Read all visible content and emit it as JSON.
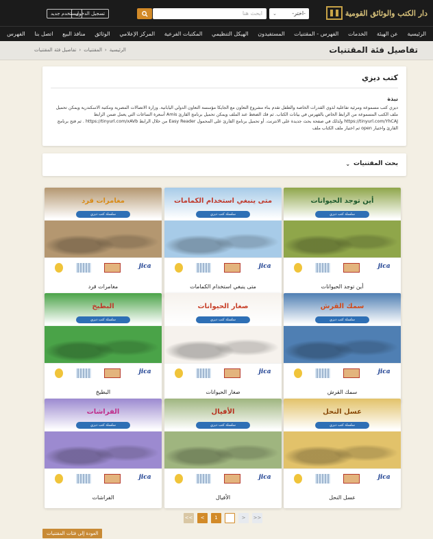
{
  "header": {
    "logo_text": "دار الكتب والوثائق القومية",
    "search_select": "-اختر-",
    "search_placeholder": "ابحث هنا",
    "search_button": "Q",
    "login": "تسجيل الدخول",
    "register": "مستخدم جديد"
  },
  "nav": [
    "الرئيسية",
    "عن الهيئة",
    "الخدمات",
    "الفهرس - المقتنيات",
    "المستفيدون",
    "الهيكل التنظيمي",
    "المكتبات الفرعية",
    "المركز الإعلامي",
    "الوثائق",
    "منافذ البيع",
    "اتصل بنا",
    "الفهرس"
  ],
  "page": {
    "title": "تفاصيل فئة المقتنيات",
    "breadcrumb": [
      "الرئيسية",
      "المقتنيات",
      "تفاصيل فئة المقتنيات"
    ]
  },
  "info": {
    "title": "كتب ديزي",
    "summary_label": "نبذة",
    "summary": "ديزي كتب مسموعة ومرئية تفاعلية لذوي القدرات الخاصة والطفل تقدم بناء مشروع التعاون مع الجايكا مؤسسة التعاون الدولي اليابانية. وزارة الاتصالات المصرية ومكتبة الاسكندرية ويمكن تحميل ملف الكتب المسموعة من الرابط الخاص بالفهرس في بيانات الكتاب. ثم فك الضغط عند الملف ويمكن تحميل برنامج القارئ Amis أسعرة الساعات التي يعمل ضمن الرابط https://tinyurl.com/YhCAJ ولذلك في صفحة بحث جديدة على الانترنت. أو تحميل برنامج القارئ على المحمول Easy Reader من خلال الرابط https://tinyurl.com/xAVb . ثم فتح برنامج القارئ واختيار open ثم اختيار ملف الكتاب ملف"
  },
  "filter": {
    "label": "بحث المقتنيات"
  },
  "books": [
    {
      "title": "أين توجد الحيوانات",
      "cover_title": "أين توجد الحيوانات",
      "cover_color": "#8fa64a",
      "title_color": "#1e5a2e"
    },
    {
      "title": "متى ينبغي استخدام الكمامات",
      "cover_title": "متى ينبغي استخدام الكمامات",
      "cover_color": "#a7cbe8",
      "title_color": "#c0392b"
    },
    {
      "title": "مغامرات قرد",
      "cover_title": "مغامرات قرد",
      "cover_color": "#b49770",
      "title_color": "#d88a16"
    },
    {
      "title": "سمك القرش",
      "cover_title": "سمك القرش",
      "cover_color": "#4f7fb3",
      "title_color": "#d24a1a"
    },
    {
      "title": "صغار الحيوانات",
      "cover_title": "صغار الحيوانات",
      "cover_color": "#f6f2ed",
      "title_color": "#c8422b"
    },
    {
      "title": "البطيخ",
      "cover_title": "البطيخ",
      "cover_color": "#4aa348",
      "title_color": "#c0392b"
    },
    {
      "title": "عسل النحل",
      "cover_title": "عسل النحل",
      "cover_color": "#e2c26a",
      "title_color": "#8a4b0a"
    },
    {
      "title": "الأفيال",
      "cover_title": "الأفيال",
      "cover_color": "#9fb57f",
      "title_color": "#b8301f"
    },
    {
      "title": "الفراشات",
      "cover_title": "الفراشات",
      "cover_color": "#9c8ad0",
      "title_color": "#c02d8a"
    }
  ],
  "cover_subtitle": "سلسلة كتب ديزي",
  "pagination": [
    "<<",
    "<",
    "1",
    "",
    ">",
    ">>"
  ],
  "back_button": "العودة إلى فئات المقتنيات"
}
